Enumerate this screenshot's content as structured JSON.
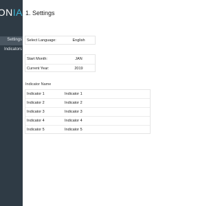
{
  "sidebar": {
    "brand_main": "ON",
    "brand_accent": "IA",
    "items": [
      {
        "label": "Settings",
        "active": true
      },
      {
        "label": "Indicators"
      }
    ]
  },
  "page": {
    "title": "1. Settings"
  },
  "language": {
    "label": "Select Language:",
    "value": "English"
  },
  "dates": [
    {
      "label": "Start Month:",
      "value": "JAN"
    },
    {
      "label": "Current Year:",
      "value": "2019"
    }
  ],
  "indicators": {
    "heading": "Indicator Name",
    "rows": [
      {
        "key": "Indicator 1",
        "value": "Indicator 1"
      },
      {
        "key": "Indicator 2",
        "value": "Indicator 2"
      },
      {
        "key": "Indicator 3",
        "value": "Indicator 3"
      },
      {
        "key": "Indicator 4",
        "value": "Indicator 4"
      },
      {
        "key": "Indicator 5",
        "value": "Indicator 5"
      }
    ]
  }
}
